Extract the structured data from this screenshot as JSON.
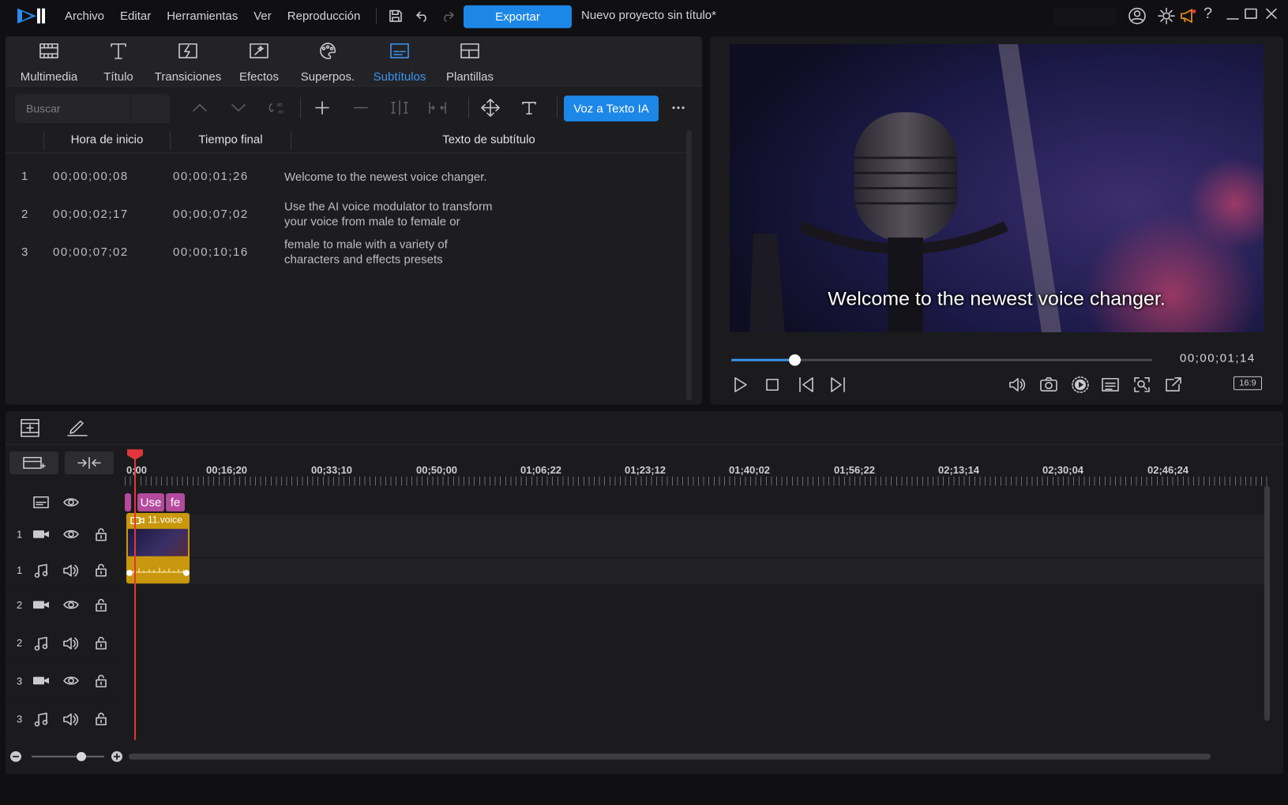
{
  "app": {
    "menu": [
      "Archivo",
      "Editar",
      "Herramientas",
      "Ver",
      "Reproducción"
    ],
    "export_label": "Exportar",
    "project_title": "Nuevo proyecto sin título*"
  },
  "tabs": [
    {
      "label": "Multimedia",
      "icon": "media-icon"
    },
    {
      "label": "Título",
      "icon": "title-icon"
    },
    {
      "label": "Transiciones",
      "icon": "transitions-icon"
    },
    {
      "label": "Efectos",
      "icon": "effects-icon"
    },
    {
      "label": "Superpos.",
      "icon": "overlay-icon"
    },
    {
      "label": "Subtítulos",
      "icon": "subtitles-icon",
      "active": true
    },
    {
      "label": "Plantillas",
      "icon": "templates-icon"
    }
  ],
  "toolbar": {
    "search_placeholder": "Buscar",
    "ai_button": "Voz a Texto IA"
  },
  "subtitles": {
    "headers": [
      "Hora de inicio",
      "Tiempo final",
      "Texto de subtítulo"
    ],
    "rows": [
      {
        "num": "1",
        "start": "00;00;00;08",
        "end": "00;00;01;26",
        "text": "Welcome to the newest voice changer."
      },
      {
        "num": "2",
        "start": "00;00;02;17",
        "end": "00;00;07;02",
        "text": "Use the AI voice modulator to transform your voice from male to female or"
      },
      {
        "num": "3",
        "start": "00;00;07;02",
        "end": "00;00;10;16",
        "text": "female to male with a variety of characters and effects presets"
      }
    ]
  },
  "preview": {
    "subtitle_overlay": "Welcome to the newest voice changer.",
    "timecode": "00;00;01;14",
    "aspect_ratio": "16:9",
    "progress_fraction": 0.15
  },
  "timeline": {
    "ruler_labels": [
      "0;00",
      "00;16;20",
      "00;33;10",
      "00;50;00",
      "01;06;22",
      "01;23;12",
      "01;40;02",
      "01;56;22",
      "02;13;14",
      "02;30;04",
      "02;46;24"
    ],
    "subtitle_clips": [
      "Use",
      "fe"
    ],
    "video_clip_name": "11.voice",
    "tracks": [
      {
        "num": "1",
        "type": "video"
      },
      {
        "num": "1",
        "type": "audio"
      },
      {
        "num": "2",
        "type": "video"
      },
      {
        "num": "2",
        "type": "audio"
      },
      {
        "num": "3",
        "type": "video"
      },
      {
        "num": "3",
        "type": "audio"
      }
    ]
  },
  "colors": {
    "accent": "#1d87e8",
    "playhead": "#e2363b",
    "subtitle_clip": "#b34a9c",
    "video_clip": "#c8970d"
  }
}
